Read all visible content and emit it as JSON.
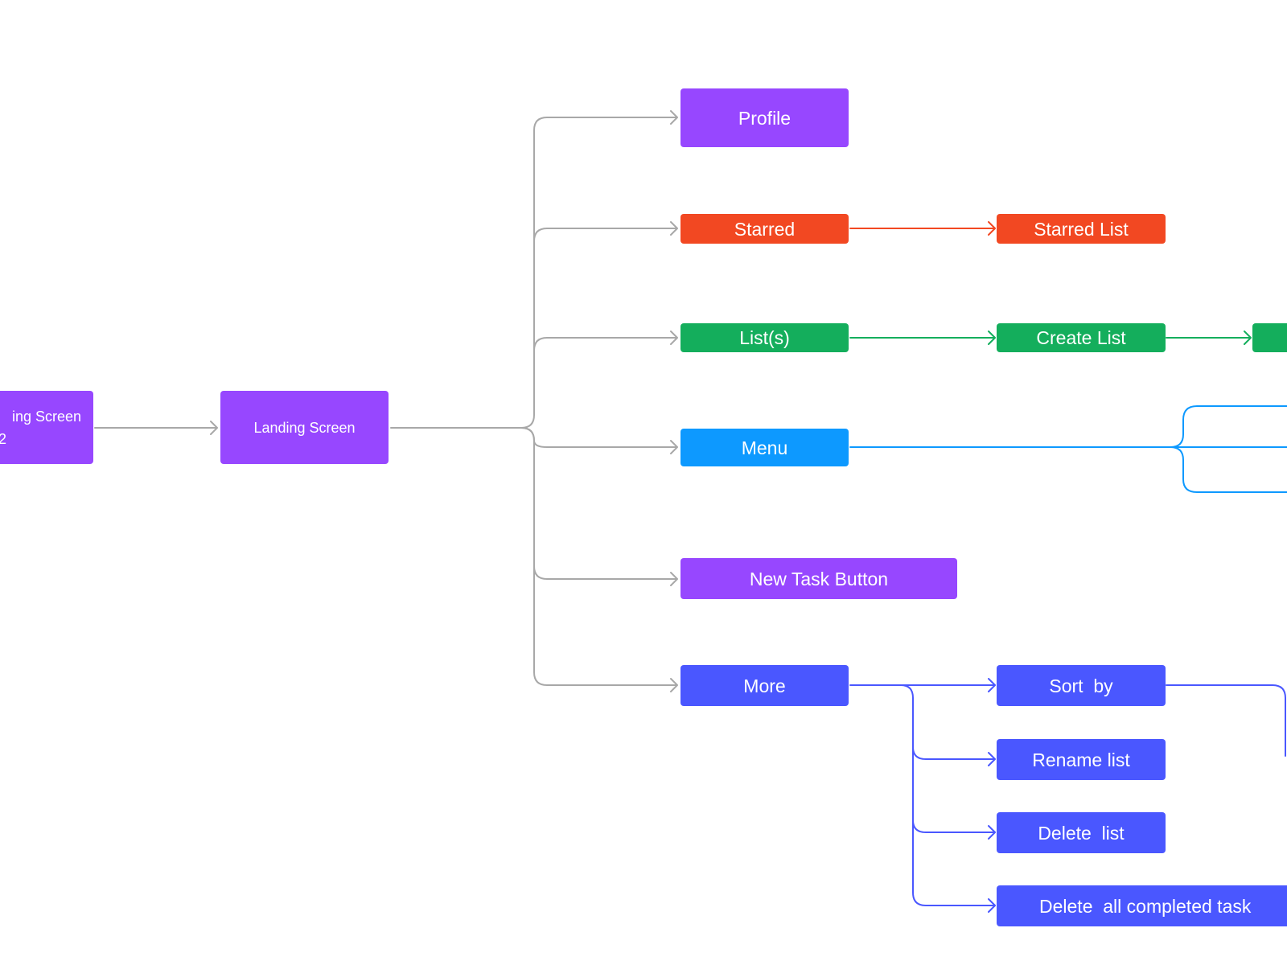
{
  "diagram": {
    "type": "flowchart",
    "colors": {
      "purple": "#9747ff",
      "red": "#f24822",
      "green": "#14ae5c",
      "sky": "#0d99ff",
      "blue": "#4a57ff",
      "connector_gray": "#a8a8a8"
    },
    "nodes": {
      "loading2": {
        "label_line1": "ing Screen",
        "label_line2": "2",
        "color": "purple"
      },
      "landing": {
        "label": "Landing Screen",
        "color": "purple"
      },
      "profile": {
        "label": "Profile",
        "color": "purple"
      },
      "starred": {
        "label": "Starred",
        "color": "red"
      },
      "starred_list": {
        "label": "Starred List",
        "color": "red"
      },
      "lists": {
        "label": "List(s)",
        "color": "green"
      },
      "create_list": {
        "label": "Create List",
        "color": "green"
      },
      "create_list_next": {
        "label": "",
        "color": "green"
      },
      "menu": {
        "label": "Menu",
        "color": "sky"
      },
      "new_task": {
        "label": "New Task Button",
        "color": "purple"
      },
      "more": {
        "label": "More",
        "color": "blue"
      },
      "sort_by": {
        "label": "Sort  by",
        "color": "blue"
      },
      "rename_list": {
        "label": "Rename list",
        "color": "blue"
      },
      "delete_list": {
        "label": "Delete  list",
        "color": "blue"
      },
      "delete_completed": {
        "label": "Delete  all completed task",
        "color": "blue"
      }
    },
    "edges": [
      {
        "from": "loading2",
        "to": "landing",
        "color": "connector_gray"
      },
      {
        "from": "landing",
        "to": "profile",
        "color": "connector_gray"
      },
      {
        "from": "landing",
        "to": "starred",
        "color": "connector_gray"
      },
      {
        "from": "landing",
        "to": "lists",
        "color": "connector_gray"
      },
      {
        "from": "landing",
        "to": "menu",
        "color": "connector_gray"
      },
      {
        "from": "landing",
        "to": "new_task",
        "color": "connector_gray"
      },
      {
        "from": "landing",
        "to": "more",
        "color": "connector_gray"
      },
      {
        "from": "starred",
        "to": "starred_list",
        "color": "red"
      },
      {
        "from": "lists",
        "to": "create_list",
        "color": "green"
      },
      {
        "from": "create_list",
        "to": "create_list_next",
        "color": "green"
      },
      {
        "from": "menu",
        "to": "offscreen-1",
        "color": "sky"
      },
      {
        "from": "menu",
        "to": "offscreen-2",
        "color": "sky"
      },
      {
        "from": "menu",
        "to": "offscreen-3",
        "color": "sky"
      },
      {
        "from": "more",
        "to": "sort_by",
        "color": "blue"
      },
      {
        "from": "more",
        "to": "rename_list",
        "color": "blue"
      },
      {
        "from": "more",
        "to": "delete_list",
        "color": "blue"
      },
      {
        "from": "more",
        "to": "delete_completed",
        "color": "blue"
      },
      {
        "from": "sort_by",
        "to": "offscreen-4",
        "color": "blue"
      }
    ]
  }
}
